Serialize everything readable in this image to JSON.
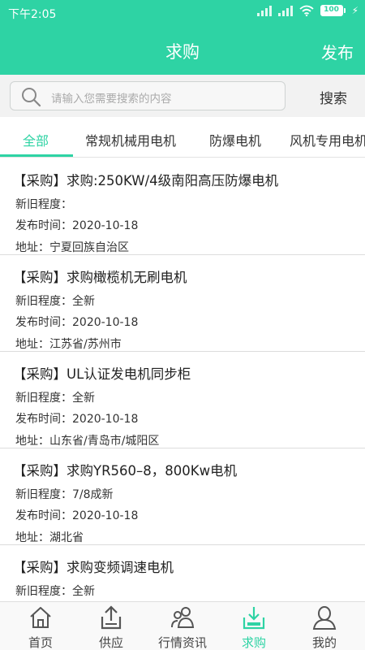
{
  "status": {
    "time": "下午2:05",
    "battery": "100"
  },
  "header": {
    "title": "求购",
    "publish_label": "发布"
  },
  "search": {
    "placeholder": "请输入您需要搜索的内容",
    "button_label": "搜索"
  },
  "tabs": [
    {
      "label": "全部",
      "active": true
    },
    {
      "label": "常规机械用电机",
      "active": false
    },
    {
      "label": "防爆电机",
      "active": false
    },
    {
      "label": "风机专用电机",
      "active": false
    }
  ],
  "items": [
    {
      "title": "【采购】求购:250KW/4级南阳高压防爆电机",
      "condition": "新旧程度：",
      "date": "发布时间：2020-10-18",
      "address": "地址：宁夏回族自治区"
    },
    {
      "title": "【采购】求购橄榄机无刷电机",
      "condition": "新旧程度：全新",
      "date": "发布时间：2020-10-18",
      "address": "地址：江苏省/苏州市"
    },
    {
      "title": "【采购】UL认证发电机同步柜",
      "condition": "新旧程度：全新",
      "date": "发布时间：2020-10-18",
      "address": "地址：山东省/青岛市/城阳区"
    },
    {
      "title": "【采购】求购YR560–8，800Kw电机",
      "condition": "新旧程度：7/8成新",
      "date": "发布时间：2020-10-18",
      "address": "地址：湖北省"
    },
    {
      "title": "【采购】求购变频调速电机",
      "condition": "新旧程度：全新",
      "date": "",
      "address": ""
    }
  ],
  "tabbar": [
    {
      "label": "首页",
      "icon": "home-icon",
      "active": false
    },
    {
      "label": "供应",
      "icon": "upload-icon",
      "active": false
    },
    {
      "label": "行情资讯",
      "icon": "people-icon",
      "active": false
    },
    {
      "label": "求购",
      "icon": "download-tray-icon",
      "active": true
    },
    {
      "label": "我的",
      "icon": "user-icon",
      "active": false
    }
  ],
  "colors": {
    "accent": "#2ed3a4",
    "text": "#222222",
    "muted": "#aaaaaa"
  }
}
